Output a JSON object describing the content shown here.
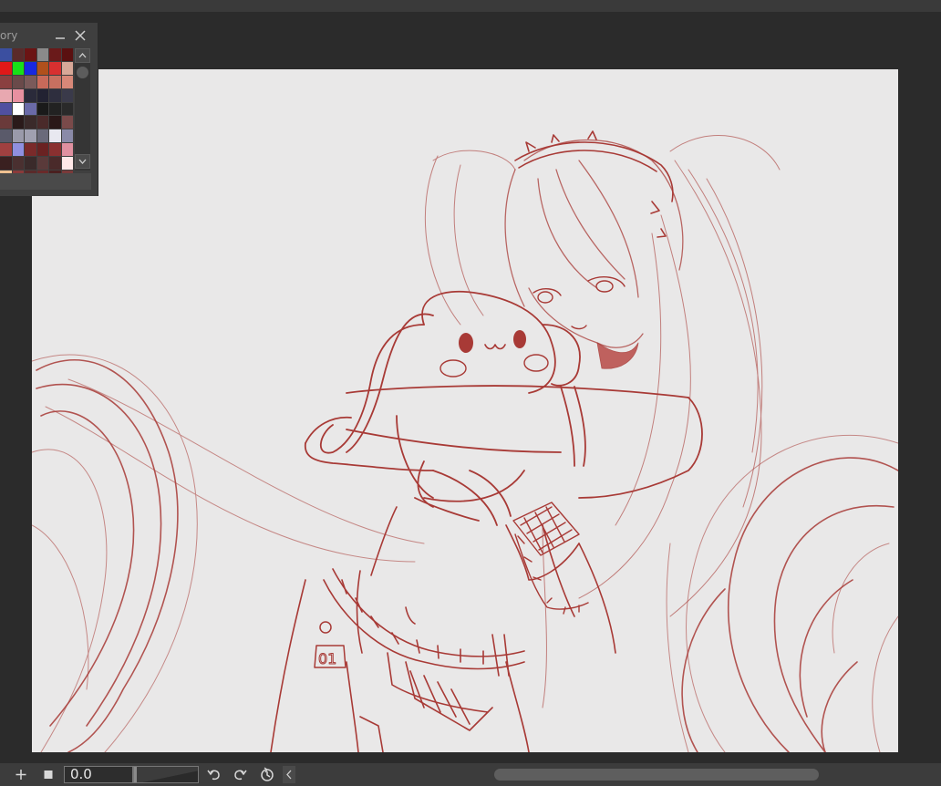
{
  "palette": {
    "title": "ory",
    "minimize_icon": "minimize-icon",
    "close_icon": "close-icon",
    "scroll_up_icon": "chevron-up-icon",
    "scroll_down_icon": "chevron-down-icon",
    "swatches": [
      "#3b4fa0",
      "#5a2a2a",
      "#6b1414",
      "#8a8a8a",
      "#6a1a1a",
      "#5a1010",
      "#e01818",
      "#18e018",
      "#1828e0",
      "#b0501c",
      "#d83030",
      "#d8a898",
      "#8a4040",
      "#6a4a4a",
      "#7a5a5a",
      "#c86a5a",
      "#c87060",
      "#d88878",
      "#e8a8b0",
      "#e890a0",
      "#2a2a3a",
      "#222232",
      "#2e2e3e",
      "#3a3a4a",
      "#5050a0",
      "#ffffff",
      "#6a6aa8",
      "#1a1a1a",
      "#222222",
      "#2a2a2a",
      "#6a3a3a",
      "#2a1a1a",
      "#3a2a2a",
      "#4a2a2a",
      "#2a1818",
      "#7a4a4a",
      "#5a5a6a",
      "#9a9aaa",
      "#a0a0b0",
      "#6a6a7a",
      "#e8e8f0",
      "#8a8aa8",
      "#a04040",
      "#9090e0",
      "#7a2a2a",
      "#6a2222",
      "#8a3030",
      "#e090a0",
      "#3a2020",
      "#4a3030",
      "#3a2a2a",
      "#5a3a3a",
      "#4a2a2a",
      "#ffe8e8",
      "#f0c090",
      "#8a3a3a",
      "#5a2a2a",
      "#6a2a2a",
      "#4a2020",
      "#7a3a3a"
    ]
  },
  "bottom_bar": {
    "add_icon": "plus-icon",
    "stop_icon": "square-icon",
    "zoom_value": "0.0",
    "undo_icon": "undo-icon",
    "redo_icon": "redo-icon",
    "reset_icon": "reset-rotation-icon",
    "scroll_left_icon": "chevron-left-icon"
  },
  "canvas": {
    "badge_text": "01",
    "stroke_color": "#a83a36",
    "paper_color": "#e9e8e8"
  }
}
